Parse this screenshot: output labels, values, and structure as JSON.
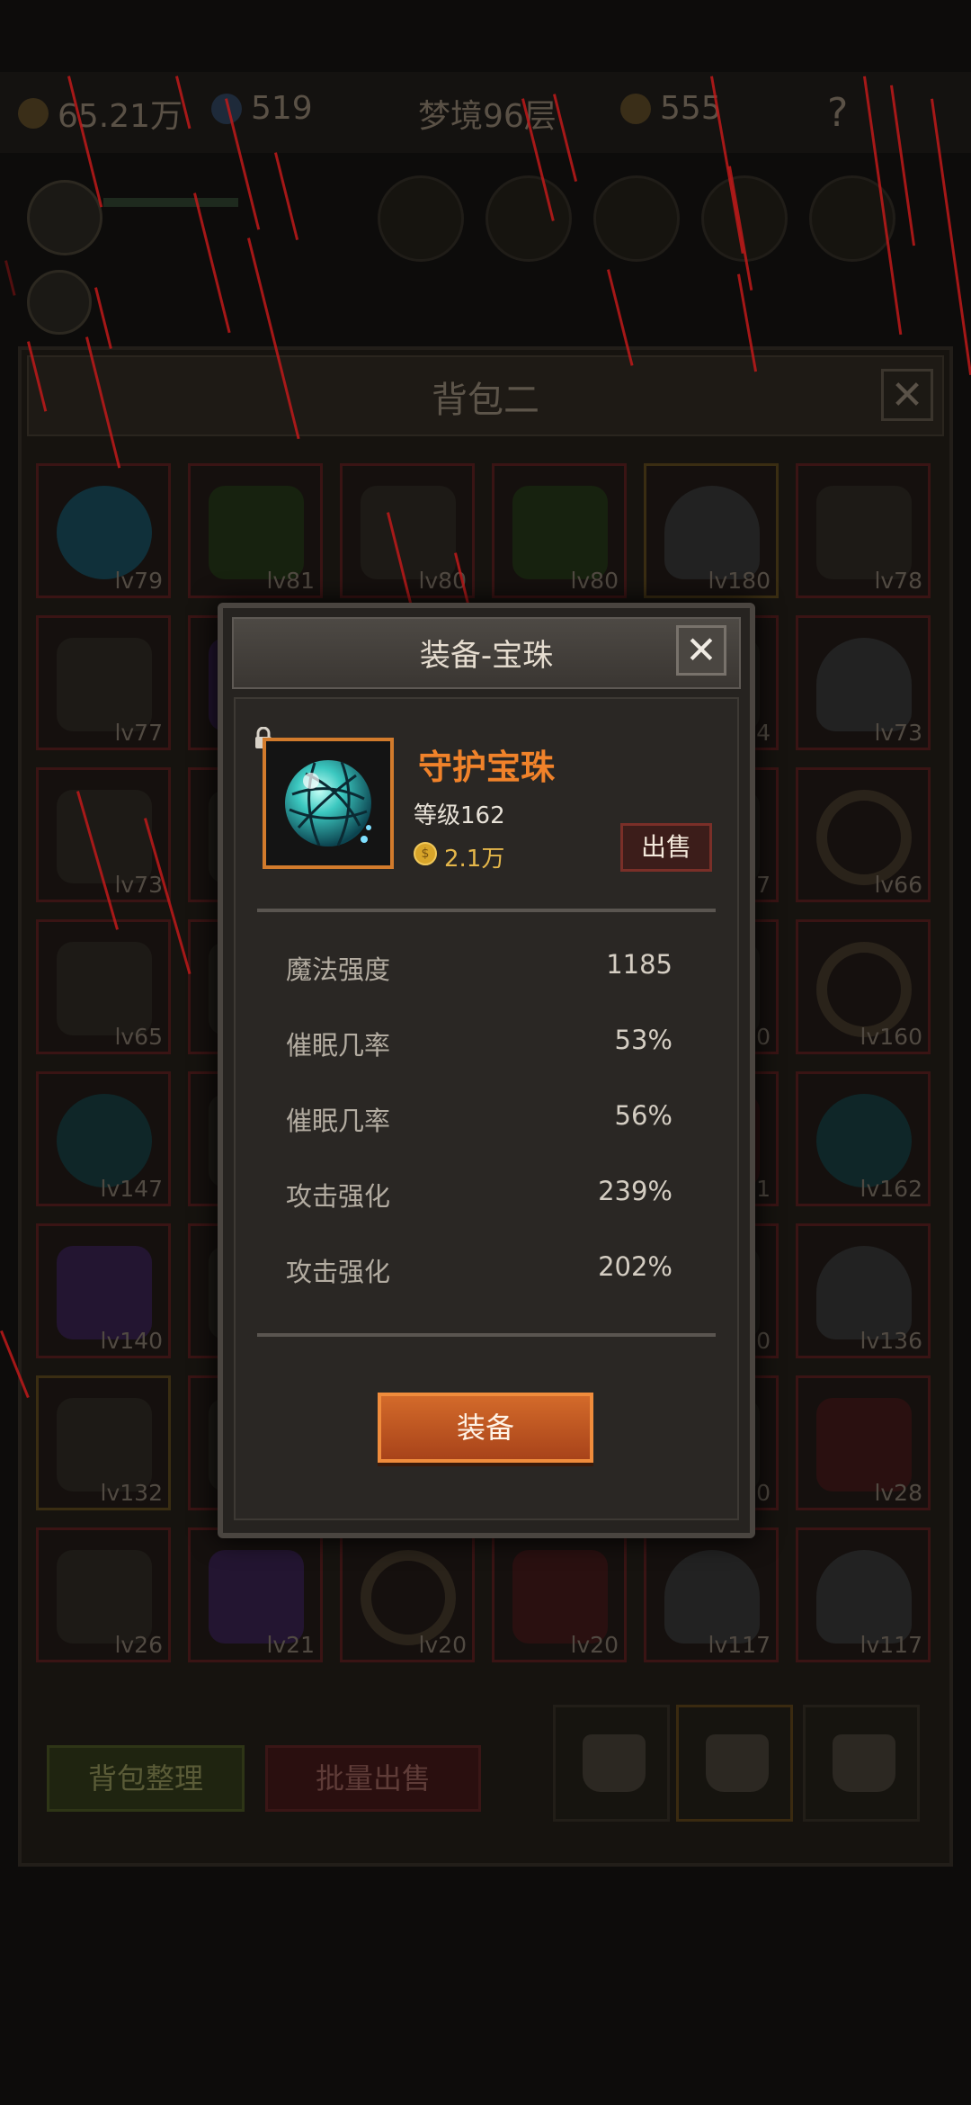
{
  "topbar": {
    "gold": "65.21万",
    "gems": "519",
    "stage": "梦境96层",
    "keys": "555"
  },
  "bag": {
    "title": "背包二",
    "sort_label": "背包整理",
    "batch_sell_label": "批量出售",
    "items": [
      {
        "lv": "lv79"
      },
      {
        "lv": "lv81"
      },
      {
        "lv": "lv80"
      },
      {
        "lv": "lv80"
      },
      {
        "lv": "lv180"
      },
      {
        "lv": "lv78"
      },
      {
        "lv": "lv77"
      },
      {
        "lv": ""
      },
      {
        "lv": ""
      },
      {
        "lv": ""
      },
      {
        "lv": "4"
      },
      {
        "lv": "lv73"
      },
      {
        "lv": "lv73"
      },
      {
        "lv": ""
      },
      {
        "lv": ""
      },
      {
        "lv": ""
      },
      {
        "lv": "7"
      },
      {
        "lv": "lv66"
      },
      {
        "lv": "lv65"
      },
      {
        "lv": ""
      },
      {
        "lv": ""
      },
      {
        "lv": ""
      },
      {
        "lv": "0"
      },
      {
        "lv": "lv160"
      },
      {
        "lv": "lv147"
      },
      {
        "lv": ""
      },
      {
        "lv": ""
      },
      {
        "lv": ""
      },
      {
        "lv": "1"
      },
      {
        "lv": "lv162"
      },
      {
        "lv": "lv140"
      },
      {
        "lv": ""
      },
      {
        "lv": ""
      },
      {
        "lv": ""
      },
      {
        "lv": "0"
      },
      {
        "lv": "lv136"
      },
      {
        "lv": "lv132"
      },
      {
        "lv": ""
      },
      {
        "lv": ""
      },
      {
        "lv": ""
      },
      {
        "lv": "0"
      },
      {
        "lv": "lv28"
      },
      {
        "lv": "lv26"
      },
      {
        "lv": "lv21"
      },
      {
        "lv": "lv20"
      },
      {
        "lv": "lv20"
      },
      {
        "lv": "lv117"
      },
      {
        "lv": "lv117"
      }
    ]
  },
  "modal": {
    "title": "装备-宝珠",
    "item_name": "守护宝珠",
    "item_level": "等级162",
    "price": "2.1万",
    "sell_label": "出售",
    "equip_label": "装备",
    "stats": [
      {
        "name": "魔法强度",
        "value": "1185"
      },
      {
        "name": "催眠几率",
        "value": "53%"
      },
      {
        "name": "催眠几率",
        "value": "56%"
      },
      {
        "name": "攻击强化",
        "value": "239%"
      },
      {
        "name": "攻击强化",
        "value": "202%"
      }
    ]
  },
  "colors": {
    "accent_orange": "#f0822a",
    "price_gold": "#e5b74a",
    "rain_red": "#c01a1a"
  },
  "icons": {
    "close": "close-icon",
    "lock": "lock-icon",
    "coin": "coin-icon",
    "orb": "orb-icon"
  }
}
